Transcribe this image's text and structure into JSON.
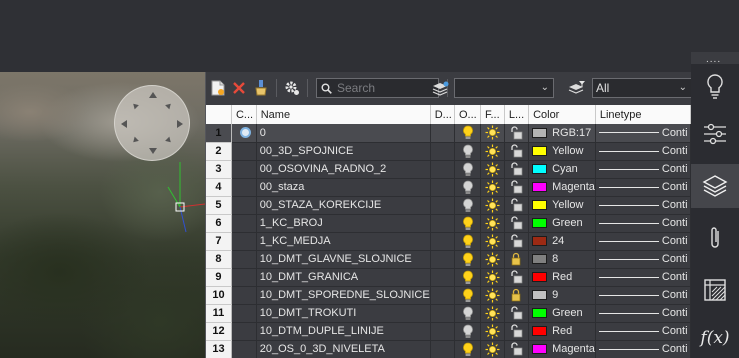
{
  "toolbar": {
    "search_placeholder": "Search",
    "filter_value": "",
    "layer_state_value": "All"
  },
  "columns": [
    "C...",
    "Name",
    "D...",
    "O...",
    "F...",
    "L...",
    "Color",
    "Linetype"
  ],
  "layers": [
    {
      "num": "1",
      "name": "0",
      "on": true,
      "locked": false,
      "color_name": "RGB:17",
      "color_hex": "#b4b4b4",
      "linetype": "Conti",
      "current": true
    },
    {
      "num": "2",
      "name": "00_3D_SPOJNICE",
      "on": false,
      "locked": false,
      "color_name": "Yellow",
      "color_hex": "#ffff00",
      "linetype": "Conti"
    },
    {
      "num": "3",
      "name": "00_OSOVINA_RADNO_2",
      "on": false,
      "locked": false,
      "color_name": "Cyan",
      "color_hex": "#00ffff",
      "linetype": "Conti"
    },
    {
      "num": "4",
      "name": "00_staza",
      "on": false,
      "locked": false,
      "color_name": "Magenta",
      "color_hex": "#ff00ff",
      "linetype": "Conti"
    },
    {
      "num": "5",
      "name": "00_STAZA_KOREKCIJE",
      "on": false,
      "locked": false,
      "color_name": "Yellow",
      "color_hex": "#ffff00",
      "linetype": "Conti"
    },
    {
      "num": "6",
      "name": "1_KC_BROJ",
      "on": true,
      "locked": false,
      "color_name": "Green",
      "color_hex": "#00ff00",
      "linetype": "Conti"
    },
    {
      "num": "7",
      "name": "1_KC_MEDJA",
      "on": true,
      "locked": false,
      "color_name": "24",
      "color_hex": "#9c2a14",
      "linetype": "Conti"
    },
    {
      "num": "8",
      "name": "10_DMT_GLAVNE_SLOJNICE",
      "on": true,
      "locked": true,
      "color_name": "8",
      "color_hex": "#808080",
      "linetype": "Conti"
    },
    {
      "num": "9",
      "name": "10_DMT_GRANICA",
      "on": true,
      "locked": false,
      "color_name": "Red",
      "color_hex": "#ff0000",
      "linetype": "Conti"
    },
    {
      "num": "10",
      "name": "10_DMT_SPOREDNE_SLOJNICE",
      "on": true,
      "locked": true,
      "color_name": "9",
      "color_hex": "#c0c0c0",
      "linetype": "Conti"
    },
    {
      "num": "11",
      "name": "10_DMT_TROKUTI",
      "on": false,
      "locked": false,
      "color_name": "Green",
      "color_hex": "#00ff00",
      "linetype": "Conti"
    },
    {
      "num": "12",
      "name": "10_DTM_DUPLE_LINIJE",
      "on": false,
      "locked": false,
      "color_name": "Red",
      "color_hex": "#ff0000",
      "linetype": "Conti"
    },
    {
      "num": "13",
      "name": "20_OS_0_3D_NIVELETA",
      "on": true,
      "locked": false,
      "color_name": "Magenta",
      "color_hex": "#ff00ff",
      "linetype": "Conti"
    }
  ],
  "right_panel": {
    "handle_label": "....",
    "buttons": [
      "lightbulb-icon",
      "sliders-icon",
      "layers-icon",
      "paperclip-icon",
      "block-table-icon",
      "function-icon"
    ],
    "fx_label": "f(x)"
  }
}
